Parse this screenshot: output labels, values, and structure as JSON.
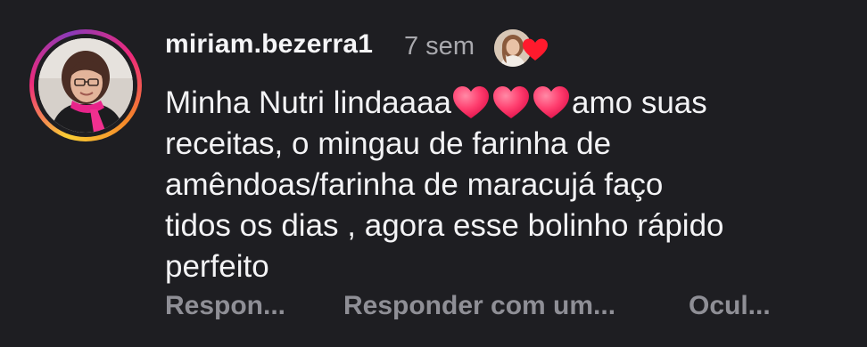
{
  "comment": {
    "username": "miriam.bezerra1",
    "timestamp": "7 sem",
    "avatar_icon": "profile-photo-woman-pink-scarf",
    "liked_by_author": {
      "avatar_icon": "author-profile-photo",
      "heart_icon": "red-heart-icon",
      "heart_color": "#ff1a2d"
    },
    "text_lines": {
      "line1_before": "Minha Nutri lindaaaa",
      "line1_after": "amo suas",
      "line2": "receitas,  o mingau de farinha de",
      "line3": "amêndoas/farinha de maracujá faço",
      "line4": "tidos os dias , agora esse bolinho rápido",
      "line5": "perfeito"
    },
    "emoji": {
      "name": "pink-heart-emoji",
      "count": 3,
      "color": "#ff3d6e"
    },
    "actions": {
      "reply": "Respon...",
      "reply_with": "Responder com um...",
      "hide": "Ocul..."
    }
  },
  "colors": {
    "background": "#1e1e22",
    "text": "#f3f3f5",
    "muted": "#a9a9ae",
    "action": "#8f8f96"
  }
}
